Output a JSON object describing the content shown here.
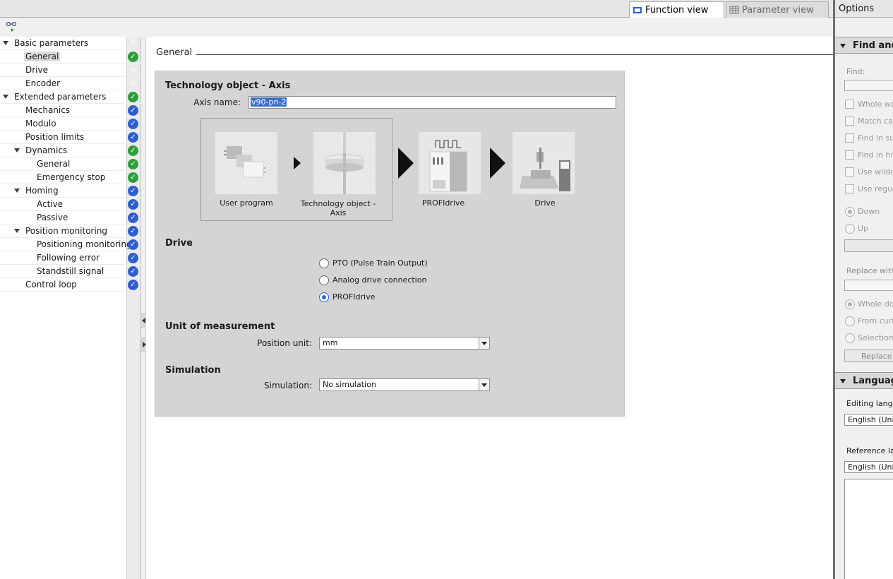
{
  "tabs": {
    "function_view": "Function view",
    "parameter_view": "Parameter view"
  },
  "tree": {
    "items": [
      {
        "label": "Basic parameters",
        "level": 0,
        "expanded": true,
        "status": "error",
        "selected": false
      },
      {
        "label": "General",
        "level": 1,
        "expanded": null,
        "status": "ok",
        "selected": true
      },
      {
        "label": "Drive",
        "level": 1,
        "expanded": null,
        "status": "error",
        "selected": false
      },
      {
        "label": "Encoder",
        "level": 1,
        "expanded": null,
        "status": "error",
        "selected": false
      },
      {
        "label": "Extended parameters",
        "level": 0,
        "expanded": true,
        "status": "ok",
        "selected": false
      },
      {
        "label": "Mechanics",
        "level": 1,
        "expanded": null,
        "status": "info",
        "selected": false
      },
      {
        "label": "Modulo",
        "level": 1,
        "expanded": null,
        "status": "info",
        "selected": false
      },
      {
        "label": "Position limits",
        "level": 1,
        "expanded": null,
        "status": "info",
        "selected": false
      },
      {
        "label": "Dynamics",
        "level": 1,
        "expanded": true,
        "status": "ok",
        "selected": false
      },
      {
        "label": "General",
        "level": 2,
        "expanded": null,
        "status": "ok",
        "selected": false
      },
      {
        "label": "Emergency stop",
        "level": 2,
        "expanded": null,
        "status": "ok",
        "selected": false
      },
      {
        "label": "Homing",
        "level": 1,
        "expanded": true,
        "status": "info",
        "selected": false
      },
      {
        "label": "Active",
        "level": 2,
        "expanded": null,
        "status": "info",
        "selected": false
      },
      {
        "label": "Passive",
        "level": 2,
        "expanded": null,
        "status": "info",
        "selected": false
      },
      {
        "label": "Position monitoring",
        "level": 1,
        "expanded": true,
        "status": "info",
        "selected": false
      },
      {
        "label": "Positioning monitoring",
        "level": 2,
        "expanded": null,
        "status": "info",
        "selected": false
      },
      {
        "label": "Following error",
        "level": 2,
        "expanded": null,
        "status": "info",
        "selected": false
      },
      {
        "label": "Standstill signal",
        "level": 2,
        "expanded": null,
        "status": "info",
        "selected": false
      },
      {
        "label": "Control loop",
        "level": 1,
        "expanded": null,
        "status": "info",
        "selected": false
      }
    ],
    "status_colors": {
      "error": "#d63a2b",
      "ok": "#2e9e3a",
      "info": "#2f5fcf"
    }
  },
  "main": {
    "section_title": "General",
    "tech_object": {
      "heading": "Technology object - Axis",
      "axis_name_label": "Axis name:",
      "axis_name_value": "v90-pn-2"
    },
    "diagram": {
      "user_program": "User program",
      "tech_object_axis": "Technology object -\nAxis",
      "profidrive": "PROFIdrive",
      "drive": "Drive"
    },
    "drive": {
      "heading": "Drive",
      "options": [
        "PTO (Pulse Train Output)",
        "Analog drive connection",
        "PROFIdrive"
      ],
      "selected_index": 2
    },
    "unit": {
      "heading": "Unit of measurement",
      "position_unit_label": "Position unit:",
      "position_unit_value": "mm"
    },
    "simulation": {
      "heading": "Simulation",
      "simulation_label": "Simulation:",
      "simulation_value": "No simulation"
    }
  },
  "options_panel": {
    "title": "Options",
    "find_section": "Find and",
    "find_label": "Find:",
    "checkboxes": [
      "Whole wo",
      "Match cas",
      "Find in su",
      "Find in hid",
      "Use wildc",
      "Use regul"
    ],
    "direction": [
      "Down",
      "Up"
    ],
    "direction_selected": 0,
    "replace_label": "Replace with",
    "scope": [
      "Whole doc",
      "From curr",
      "Selection"
    ],
    "scope_selected": 0,
    "replace_button": "Replace",
    "language_section": "Language",
    "editing_label": "Editing langu",
    "editing_value": "English (Uni",
    "reference_label": "Reference la",
    "reference_value": "English (Uni"
  }
}
